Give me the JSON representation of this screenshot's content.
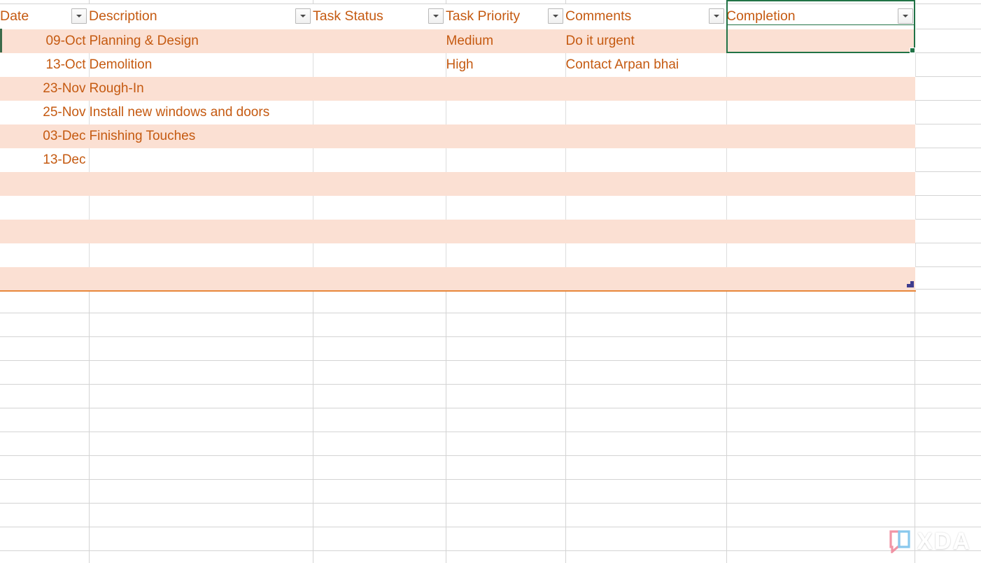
{
  "table": {
    "name": "project-task-table",
    "columns": [
      {
        "key": "date",
        "label": "Date",
        "filter_icon": "chevron-down-icon",
        "align": "right"
      },
      {
        "key": "desc",
        "label": "Description",
        "filter_icon": "chevron-down-icon",
        "align": "left"
      },
      {
        "key": "status",
        "label": "Task Status",
        "filter_icon": "chevron-down-icon",
        "align": "left"
      },
      {
        "key": "priority",
        "label": "Task Priority",
        "filter_icon": "chevron-down-icon",
        "align": "left"
      },
      {
        "key": "comments",
        "label": "Comments",
        "filter_icon": "chevron-down-icon",
        "align": "left"
      },
      {
        "key": "completion",
        "label": "Completion",
        "filter_icon": "chevron-down-icon",
        "align": "left"
      }
    ],
    "rows": [
      {
        "date": "09-Oct",
        "desc": "Planning & Design",
        "status": "",
        "priority": "Medium",
        "comments": "Do it urgent",
        "completion": ""
      },
      {
        "date": "13-Oct",
        "desc": "Demolition",
        "status": "",
        "priority": "High",
        "comments": "Contact Arpan bhai",
        "completion": ""
      },
      {
        "date": "23-Nov",
        "desc": "Rough-In",
        "status": "",
        "priority": "",
        "comments": "",
        "completion": ""
      },
      {
        "date": "25-Nov",
        "desc": "Install new windows and doors",
        "status": "",
        "priority": "",
        "comments": "",
        "completion": ""
      },
      {
        "date": "03-Dec",
        "desc": "Finishing Touches",
        "status": "",
        "priority": "",
        "comments": "",
        "completion": ""
      },
      {
        "date": "13-Dec",
        "desc": "",
        "status": "",
        "priority": "",
        "comments": "",
        "completion": ""
      },
      {
        "date": "",
        "desc": "",
        "status": "",
        "priority": "",
        "comments": "",
        "completion": ""
      },
      {
        "date": "",
        "desc": "",
        "status": "",
        "priority": "",
        "comments": "",
        "completion": ""
      },
      {
        "date": "",
        "desc": "",
        "status": "",
        "priority": "",
        "comments": "",
        "completion": ""
      },
      {
        "date": "",
        "desc": "",
        "status": "",
        "priority": "",
        "comments": "",
        "completion": ""
      },
      {
        "date": "",
        "desc": "",
        "status": "",
        "priority": "",
        "comments": "",
        "completion": ""
      }
    ]
  },
  "selection": {
    "active_cell_column": "Completion",
    "fill_handle": "fill-handle",
    "resize_handle": "table-resize-handle"
  },
  "watermark": {
    "text": "XDA"
  },
  "colors": {
    "accent_text": "#C55A11",
    "band_fill": "#FBE0D3",
    "table_border": "#E8873C",
    "selection": "#217346",
    "gridline": "#D4D4D4",
    "resize_handle": "#3F3D8F"
  }
}
